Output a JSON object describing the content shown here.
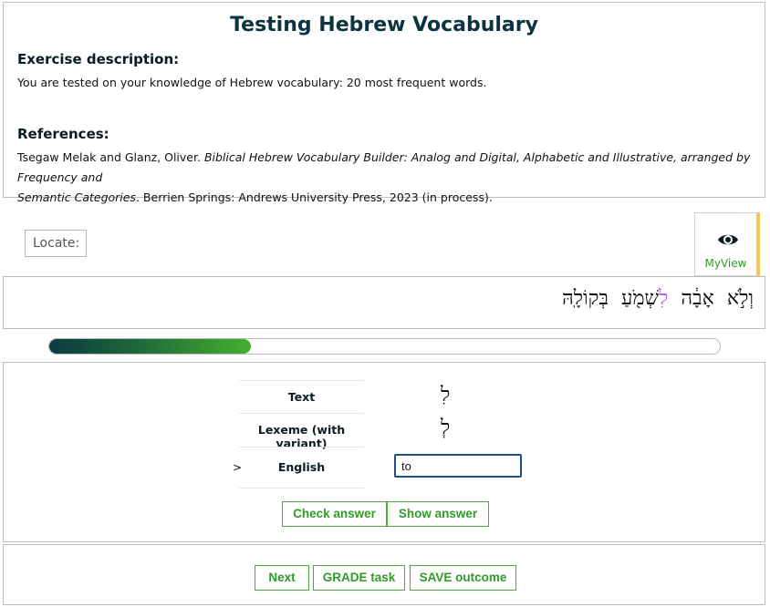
{
  "header": {
    "title": "Testing Hebrew Vocabulary",
    "exercise_heading": "Exercise description:",
    "exercise_text": "You are tested on your knowledge of Hebrew vocabulary: 20 most frequent words.",
    "references_heading": "References:",
    "ref_authors": "Tsegaw Melak and Glanz, Oliver. ",
    "ref_title_line1": "Biblical Hebrew Vocabulary Builder: Analog and Digital, Alphabetic and Illustrative, arranged by Frequency and",
    "ref_title_line2": "Semantic Categories",
    "ref_rest": ". Berrien Springs: Andrews University Press, 2023 (in process)."
  },
  "toolbar": {
    "locate_label": "Locate:",
    "myview_label": "MyView",
    "myview_icon": "eye-icon",
    "accent": "#2e9c26"
  },
  "text_panel": {
    "words": [
      "וְלֹ֣א",
      "אָבָ֔ה",
      "לִ",
      "שְׁמֹ֖עַ",
      "בְּקוֹלָֽהּ"
    ],
    "highlight_index": 2,
    "highlight_color": "#b561e8"
  },
  "progress": {
    "fraction": 0.3
  },
  "question": {
    "rows": [
      {
        "label": "Text",
        "value": "לִ"
      },
      {
        "label": "Lexeme (with variant)",
        "value": "לְ"
      },
      {
        "label": "English",
        "value": ""
      }
    ],
    "current_marker": ">",
    "answer_value": "to",
    "check_label": "Check answer",
    "show_label": "Show answer"
  },
  "footer": {
    "next_label": "Next",
    "grade_label": "GRADE task",
    "save_label": "SAVE outcome"
  }
}
